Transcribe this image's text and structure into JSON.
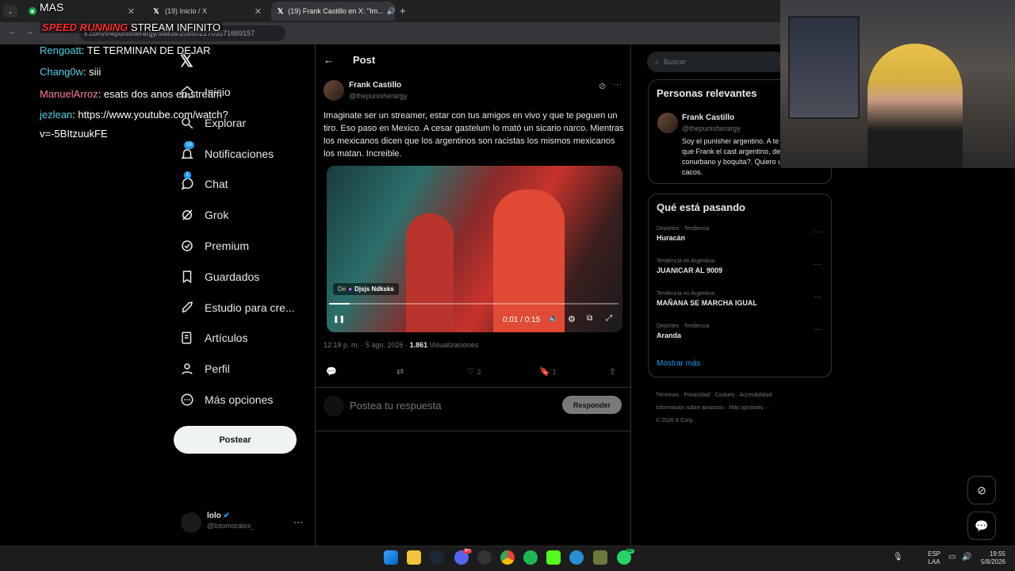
{
  "browser": {
    "tabs": [
      {
        "label": "(19) Inicio / X"
      },
      {
        "label": "(19) Frank Castillo en X: \"Im..."
      }
    ],
    "url": "x.com/thepunisherargy/status/2085022703571669157"
  },
  "overlay": {
    "top_label": "MAS",
    "stream_title_a": "SPEED RUNNING",
    "stream_title_b": "STREAM INFINITO",
    "chat": [
      {
        "user": "Rengoatt",
        "user_color": "#4fd1e8",
        "msg": ": TE TERMINAN DE DEJAR"
      },
      {
        "user": "Chang0w",
        "user_color": "#4fd1e8",
        "msg": ": siii"
      },
      {
        "user": "ManuelArroz",
        "user_color": "#ff7a9c",
        "msg": ": esats dos anos en stream"
      },
      {
        "user": "jezlean",
        "user_color": "#4fd1e8",
        "msg": ": https://www.youtube.com/watch?"
      },
      {
        "user": "",
        "user_color": "#ffffff",
        "msg": "v=-5BItzuukFE"
      }
    ]
  },
  "sidebar": {
    "items": [
      {
        "label": "Inicio",
        "icon": "home-icon"
      },
      {
        "label": "Explorar",
        "icon": "search-icon"
      },
      {
        "label": "Notificaciones",
        "icon": "bell-icon",
        "badge": "18"
      },
      {
        "label": "Chat",
        "icon": "chat-icon",
        "badge": "1"
      },
      {
        "label": "Grok",
        "icon": "grok-icon"
      },
      {
        "label": "Premium",
        "icon": "verified-icon"
      },
      {
        "label": "Guardados",
        "icon": "bookmark-icon"
      },
      {
        "label": "Estudio para cre...",
        "icon": "rocket-icon"
      },
      {
        "label": "Artículos",
        "icon": "article-icon"
      },
      {
        "label": "Perfil",
        "icon": "person-icon"
      },
      {
        "label": "Más opciones",
        "icon": "more-circle-icon"
      }
    ],
    "post_button": "Postear",
    "account": {
      "name": "lolo",
      "handle": "@lolomorales_"
    }
  },
  "main": {
    "header": "Post",
    "author": {
      "name": "Frank Castillo",
      "handle": "@thepunisherargy"
    },
    "text": "Imaginate ser un streamer, estar con tus amigos en vivo y que te peguen un tiro. Eso paso en Mexico. A cesar gastelum lo mató un sicario narco. Mientras los mexicanos dicen que los argentinos son racistas los mismos mexicanos los matan. Increible.",
    "video": {
      "source_prefix": "De",
      "source_name": "Djsjs Ndksks",
      "time": "0:01 / 0:15",
      "progress": 0.07
    },
    "timestamp": "12:18 p. m. · 5 ago. 2026 ·",
    "views_count": "1.861",
    "views_label": "Visualizaciones",
    "stats": {
      "likes": "2",
      "bookmarks": "1"
    },
    "reply_placeholder": "Postea tu respuesta",
    "reply_button": "Responder"
  },
  "right": {
    "search_placeholder": "Buscar",
    "relevant_title": "Personas relevantes",
    "relevant_person": {
      "name": "Frank Castillo",
      "handle": "@thepunisherargy",
      "bio": "Soy el punisher argentino. A te dijeron que Frank el cast argentino, del conurbano y boquita?. Quiero un pais sin cacos."
    },
    "trends_title": "Qué está pasando",
    "trends": [
      {
        "category": "Deportes · Tendencia",
        "name": "Huracán"
      },
      {
        "category": "Tendencia en Argentina",
        "name": "JUANICAR AL 9009"
      },
      {
        "category": "Tendencia en Argentina",
        "name": "MAÑANA SE MARCHA IGUAL"
      },
      {
        "category": "Deportes · Tendencia",
        "name": "Aranda"
      }
    ],
    "show_more": "Mostrar más",
    "footer": [
      "Términos",
      "Privacidad",
      "Cookies",
      "Accesibilidad",
      "Información sobre anuncios",
      "Más opciones ···",
      "© 2026 X Corp."
    ]
  },
  "taskbar": {
    "lang": "ESP",
    "lang2": "LAA",
    "time": "19:55",
    "date": "5/8/2026",
    "badges": {
      "discord": "9+",
      "whatsapp": "60"
    }
  },
  "colors": {
    "accent": "#1d9bf0",
    "bg": "#000000",
    "border": "#2f3336"
  }
}
